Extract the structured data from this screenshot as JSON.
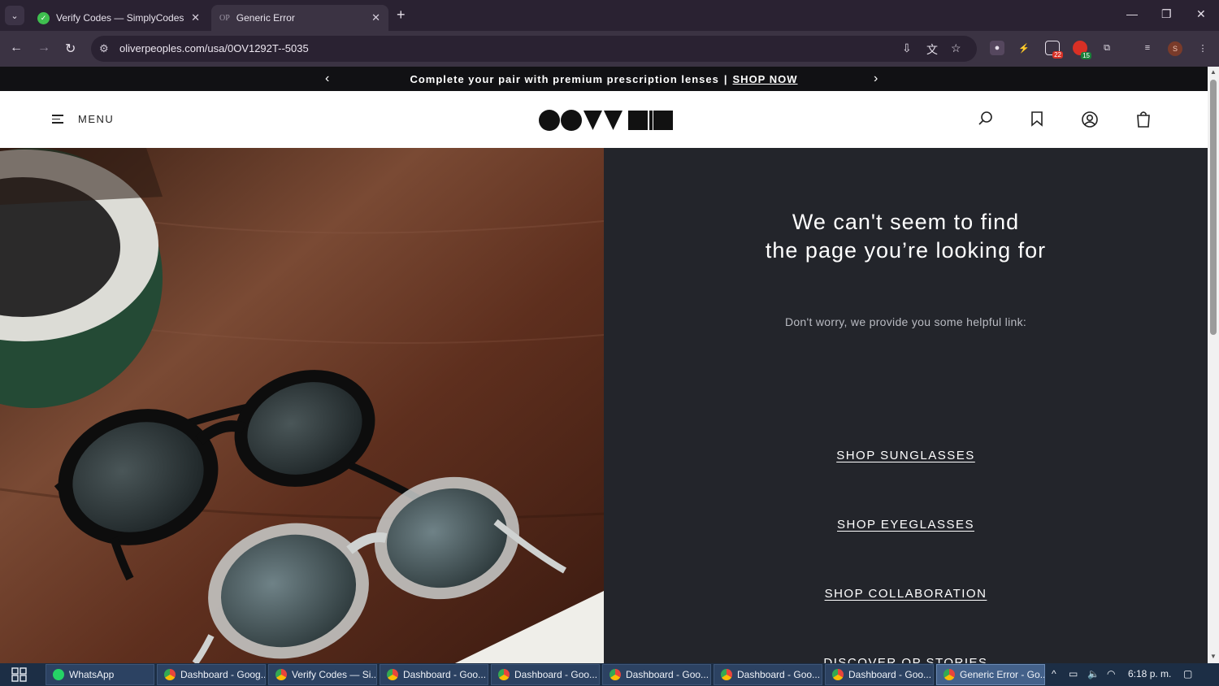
{
  "browser": {
    "tabs": [
      {
        "title": "Verify Codes — SimplyCodes",
        "active": false
      },
      {
        "title": "Generic Error",
        "favicon_text": "OP",
        "active": true
      }
    ],
    "url": "oliverpeoples.com/usa/0OV1292T--5035",
    "extensions": [
      {
        "name": "puzzle-icon"
      },
      {
        "name": "lightning-icon"
      },
      {
        "name": "screen-extension-icon",
        "badge": "22"
      },
      {
        "name": "shield-extension-icon",
        "badge": "15"
      }
    ],
    "profile_initial": "S"
  },
  "page": {
    "promo": {
      "text": "Complete your pair with premium prescription lenses",
      "separator": "|",
      "cta": "SHOP NOW"
    },
    "header": {
      "menu_label": "MENU"
    },
    "error": {
      "headline_line1": "We can't seem to find",
      "headline_line2": "the page you’re looking for",
      "subtext": "Don't worry, we provide you some helpful link:",
      "links": [
        "SHOP SUNGLASSES",
        "SHOP EYEGLASSES",
        "SHOP COLLABORATION",
        "DISCOVER OP STORIES"
      ]
    }
  },
  "taskbar": {
    "items": [
      {
        "label": "WhatsApp",
        "color": "#25d366"
      },
      {
        "label": "Dashboard - Goog...",
        "color": "#e8453c"
      },
      {
        "label": "Verify Codes — Si...",
        "color": "#e8453c"
      },
      {
        "label": "Dashboard - Goo...",
        "color": "#e8453c"
      },
      {
        "label": "Dashboard - Goo...",
        "color": "#e8453c"
      },
      {
        "label": "Dashboard - Goo...",
        "color": "#e8453c"
      },
      {
        "label": "Dashboard - Goo...",
        "color": "#e8453c"
      },
      {
        "label": "Dashboard - Goo...",
        "color": "#e8453c"
      },
      {
        "label": "Generic Error - Go...",
        "color": "#e8453c",
        "active": true
      }
    ],
    "time": "6:18 p. m."
  }
}
